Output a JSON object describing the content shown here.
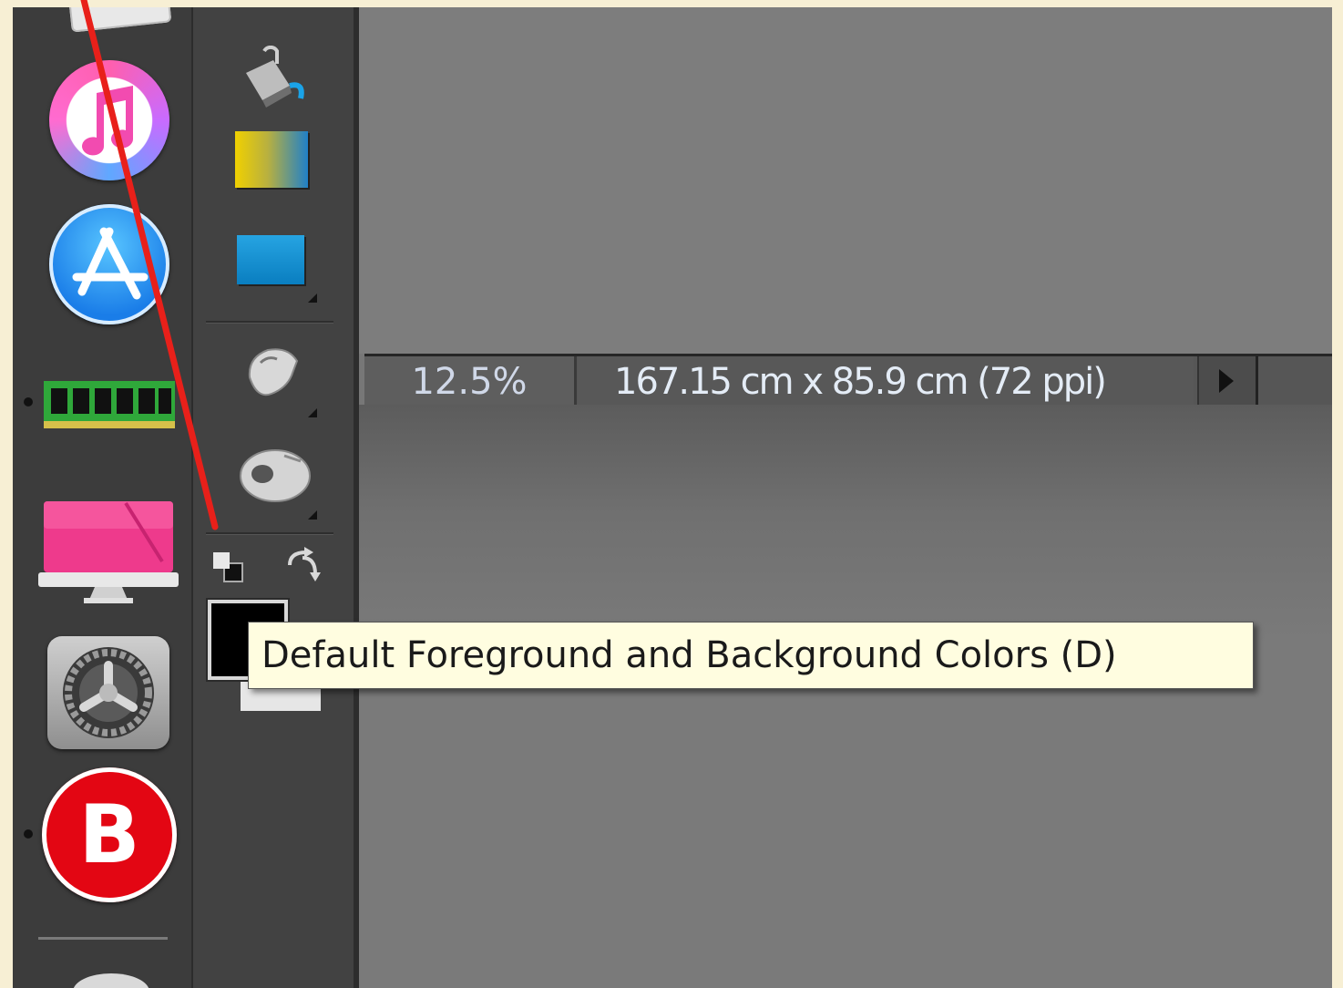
{
  "status_bar": {
    "zoom": "12.5%",
    "document_size": "167.15 cm x 85.9 cm (72 ppi)",
    "menu_arrow_icon": "triangle-right-icon"
  },
  "tooltip": {
    "text": "Default Foreground and Background Colors (D)"
  },
  "dock": {
    "items": [
      {
        "name": "iTunes",
        "icon": "itunes-icon"
      },
      {
        "name": "App Store",
        "icon": "app-store-icon"
      },
      {
        "name": "Memory",
        "icon": "ram-icon"
      },
      {
        "name": "CleanMyMac",
        "icon": "cleanmymac-icon"
      },
      {
        "name": "System Preferences",
        "icon": "gear-icon"
      },
      {
        "name": "Bitdefender",
        "icon": "bitdefender-icon",
        "letter": "B"
      }
    ]
  },
  "tools": {
    "items": [
      "paint-bucket-icon",
      "gradient-icon",
      "shape-icon",
      "smudge-icon",
      "hand-icon",
      "default-colors-icon",
      "swap-colors-icon"
    ],
    "foreground_color": "#000000",
    "background_color": "#e6e6e6"
  },
  "colors": {
    "annotation_line": "#e8201a",
    "tooltip_bg": "#fffde0",
    "page_bg": "#f7efd4"
  }
}
